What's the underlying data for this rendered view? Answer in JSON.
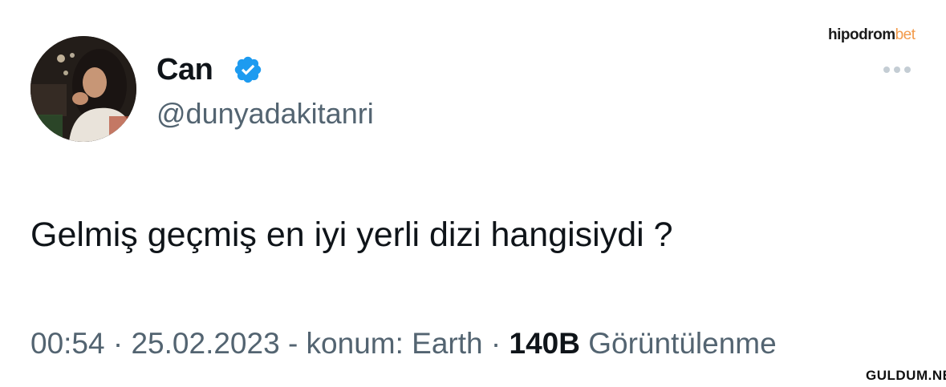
{
  "brand": {
    "main": "hipodrom",
    "accent_part": "bet",
    "accent_color": "#f29a4a"
  },
  "tweet": {
    "author_name": "Can",
    "verified": true,
    "verified_color": "#1d9bf0",
    "handle": "@dunyadakitanri",
    "more_icon": "more-dots-icon",
    "text": "Gelmiş geçmiş en iyi yerli dizi hangisiydi ?",
    "meta": {
      "time": "00:54",
      "separator_1": " · ",
      "date": "25.02.2023",
      "location_prefix": " - konum: ",
      "location": "Earth",
      "separator_2": " · ",
      "views_count": "140B",
      "views_label": " Görüntülenme"
    }
  },
  "watermark": "GULDUM.NET"
}
